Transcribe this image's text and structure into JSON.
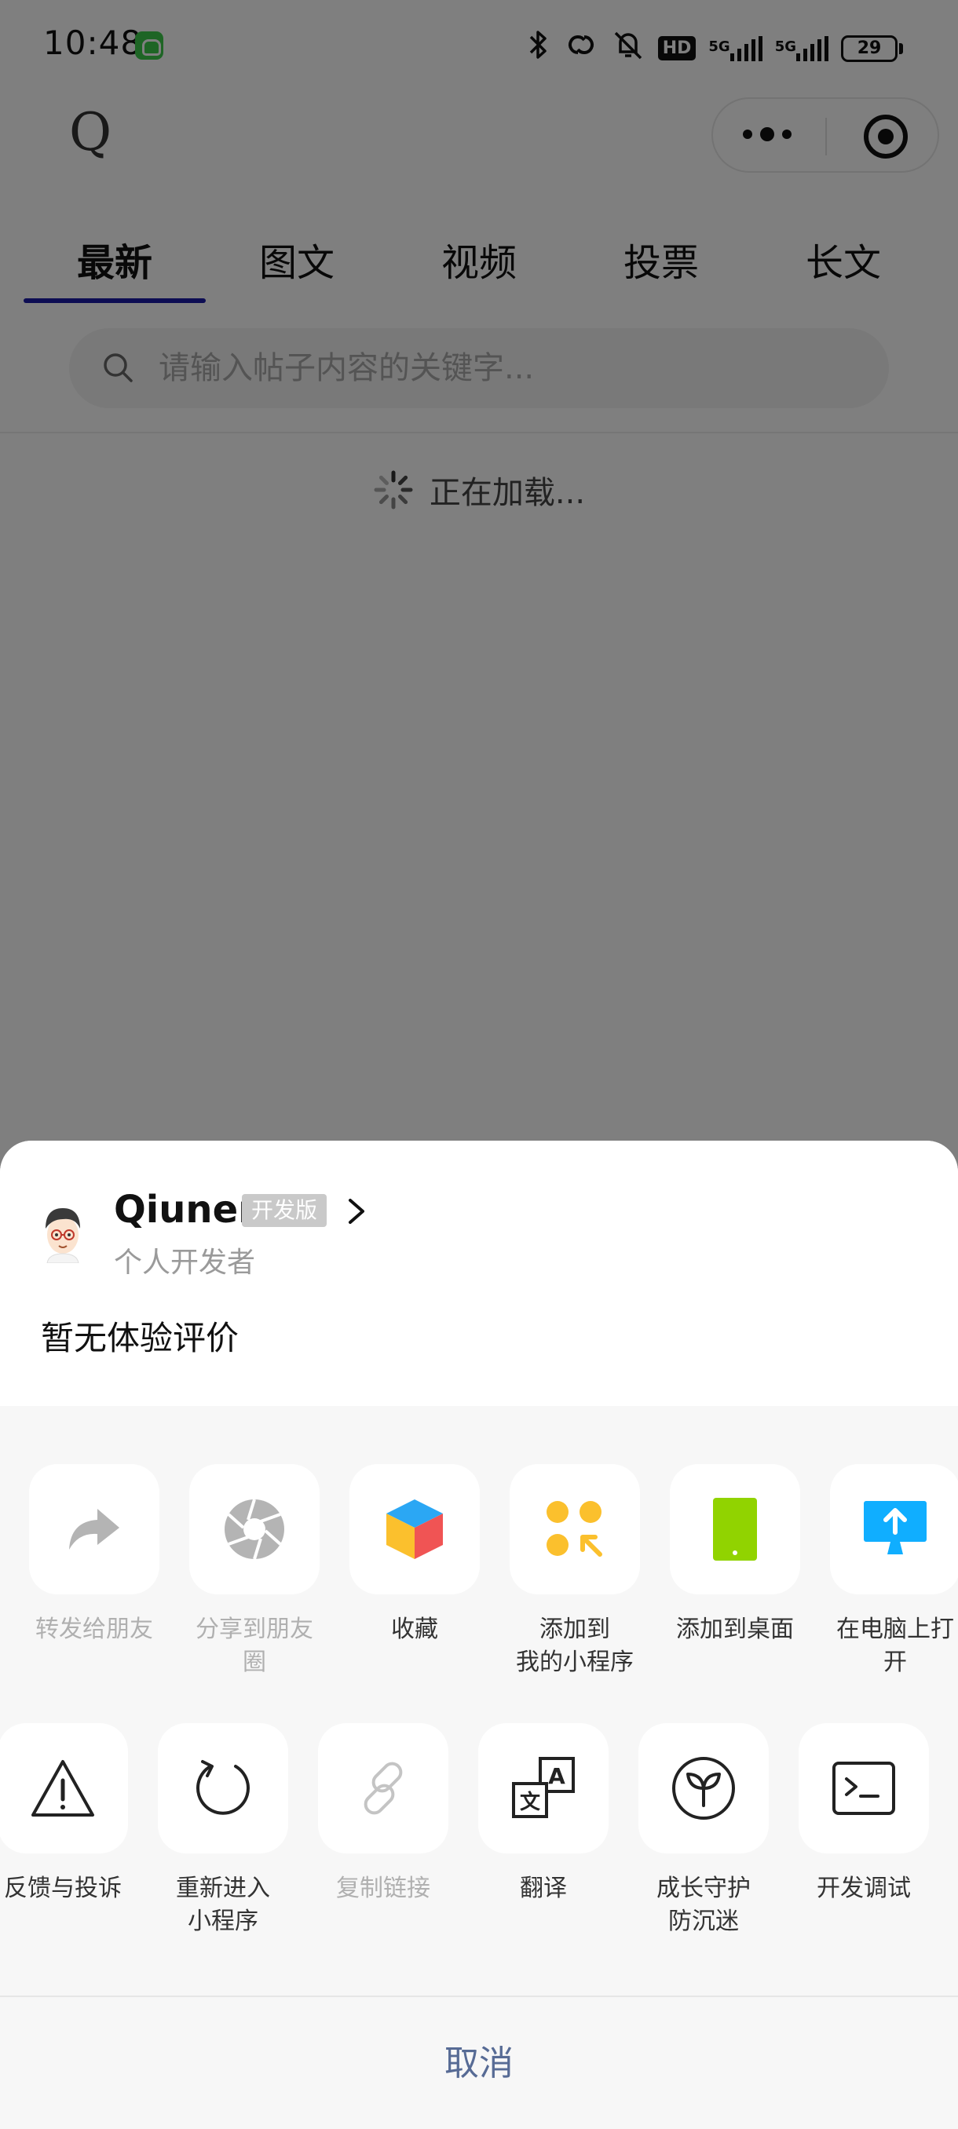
{
  "status_bar": {
    "time": "10:48",
    "net_label_1": "5G",
    "net_label_2": "5G",
    "hd_label": "HD",
    "battery": "29"
  },
  "nav": {
    "logo": "Q"
  },
  "tabs": [
    {
      "label": "最新",
      "active": true
    },
    {
      "label": "图文",
      "active": false
    },
    {
      "label": "视频",
      "active": false
    },
    {
      "label": "投票",
      "active": false
    },
    {
      "label": "长文",
      "active": false
    }
  ],
  "search": {
    "placeholder": "请输入帖子内容的关键字..."
  },
  "loading": {
    "text": "正在加载..."
  },
  "sheet": {
    "app_name": "Qiuner",
    "badge": "开发版",
    "developer_type": "个人开发者",
    "review": "暂无体验评价",
    "row1": [
      {
        "label": "转发给朋友",
        "icon": "share-arrow-icon",
        "disabled": true
      },
      {
        "label": "分享到朋友\n圈",
        "icon": "moments-icon",
        "disabled": true
      },
      {
        "label": "收藏",
        "icon": "favorite-cube-icon",
        "disabled": false
      },
      {
        "label": "添加到\n我的小程序",
        "icon": "my-miniprogram-icon",
        "disabled": false
      },
      {
        "label": "添加到桌面",
        "icon": "phone-icon",
        "disabled": false
      },
      {
        "label": "在电脑上打\n开",
        "icon": "computer-upload-icon",
        "disabled": false
      }
    ],
    "row2": [
      {
        "label": "反馈与投诉",
        "icon": "warning-icon",
        "disabled": false
      },
      {
        "label": "重新进入\n小程序",
        "icon": "reload-icon",
        "disabled": false
      },
      {
        "label": "复制链接",
        "icon": "link-icon",
        "disabled": true
      },
      {
        "label": "翻译",
        "icon": "translate-icon",
        "disabled": false
      },
      {
        "label": "成长守护\n防沉迷",
        "icon": "sprout-icon",
        "disabled": false
      },
      {
        "label": "开发调试",
        "icon": "terminal-icon",
        "disabled": false
      }
    ],
    "cancel": "取消"
  },
  "colors": {
    "tab_underline": "#1a1aa6",
    "cancel_text": "#576b95",
    "favorite_blue": "#2ba7f4",
    "favorite_yellow": "#fbc02d",
    "favorite_red": "#f05454",
    "miniprogram_yellow": "#fbc02d",
    "desktop_green": "#91d300",
    "computer_blue": "#10aeff"
  }
}
